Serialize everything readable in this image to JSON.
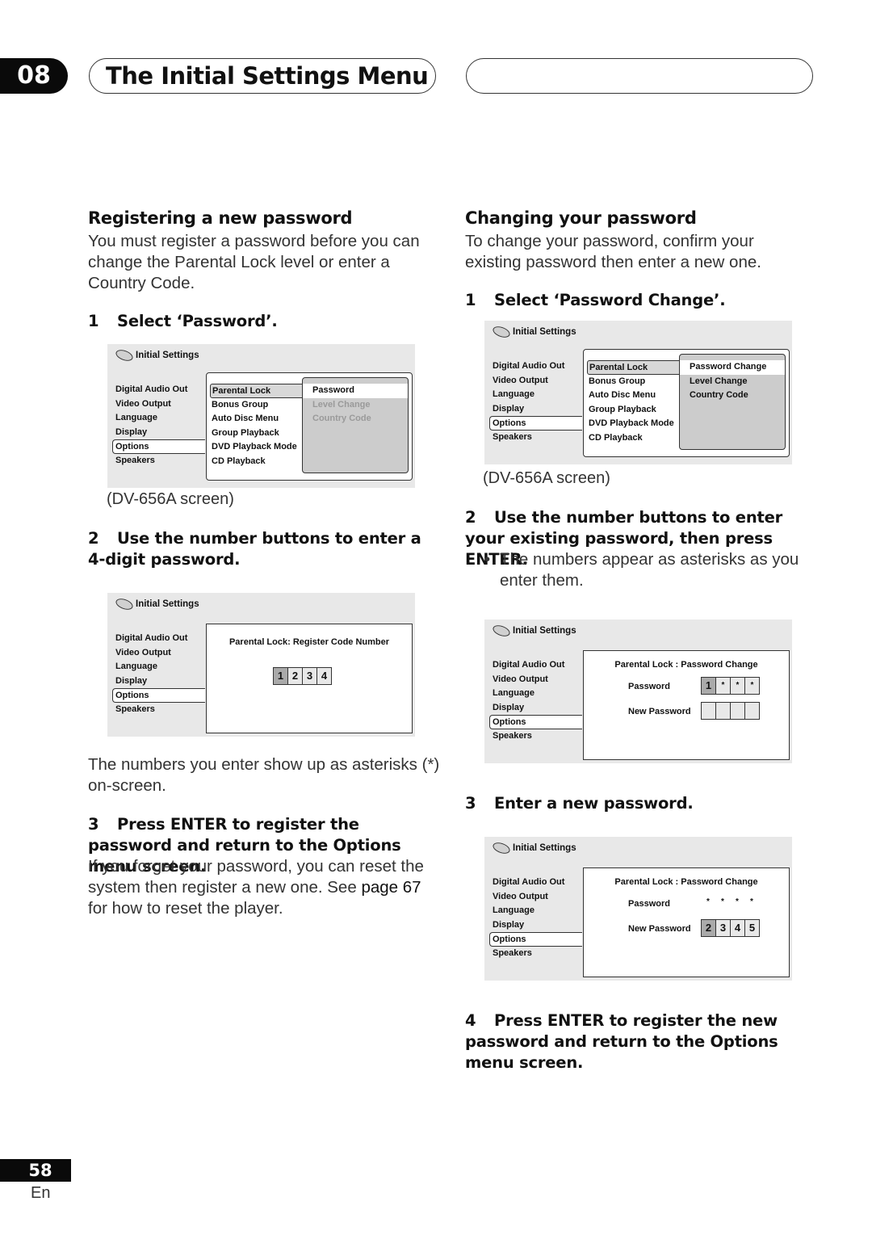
{
  "header": {
    "chapter_number": "08",
    "chapter_title": "The Initial Settings Menu"
  },
  "left": {
    "heading": "Registering a new password",
    "intro": "You must register a password before you can change the Parental Lock level or enter a Country Code.",
    "steps": [
      {
        "num": "1",
        "text": "Select ‘Password’."
      },
      {
        "num": "2",
        "text": "Use the number buttons to enter a 4-digit password."
      },
      {
        "num": "3",
        "text": "Press ENTER to register the password and return to the Options menu screen."
      }
    ],
    "caption1": "(DV-656A screen)",
    "after_step2": "The numbers you enter show up as asterisks (*) on-screen.",
    "after_step3_pre": "If you forget your password, you can reset the system then register a new one. See ",
    "after_step3_bold": "page 67",
    "after_step3_post": " for how to reset the player."
  },
  "right": {
    "heading": "Changing your password",
    "intro": "To change your password, confirm your existing password then enter a new one.",
    "steps": [
      {
        "num": "1",
        "text": "Select ‘Password Change’."
      },
      {
        "num": "2",
        "text": "Use the number buttons to enter your existing password, then press ENTER."
      },
      {
        "num": "3",
        "text": "Enter a new password."
      },
      {
        "num": "4",
        "text": "Press ENTER to register the new password and return to the Options menu screen."
      }
    ],
    "caption1": "(DV-656A screen)",
    "bullet": "The numbers appear as asterisks as you enter them."
  },
  "osd": {
    "title": "Initial Settings",
    "main_menu": [
      "Digital Audio Out",
      "Video Output",
      "Language",
      "Display",
      "Options",
      "Speakers"
    ],
    "options_menu": [
      "Parental Lock",
      "Bonus Group",
      "Auto Disc Menu",
      "Group Playback",
      "DVD Playback Mode",
      "CD Playback"
    ],
    "screen1_sub": [
      "Password",
      "Level Change",
      "Country Code"
    ],
    "screen2_title": "Parental Lock: Register Code Number",
    "screen2_digits": [
      "1",
      "2",
      "3",
      "4"
    ],
    "screen3_sub": [
      "Password Change",
      "Level Change",
      "Country Code"
    ],
    "pc_title": "Parental Lock : Password Change",
    "password_label": "Password",
    "new_password_label": "New Password",
    "screen4_password": [
      "1",
      "*",
      "*",
      "*"
    ],
    "screen5_password": [
      "*",
      "*",
      "*",
      "*"
    ],
    "screen5_new": [
      "2",
      "3",
      "4",
      "5"
    ]
  },
  "footer": {
    "page_number": "58",
    "language": "En"
  }
}
